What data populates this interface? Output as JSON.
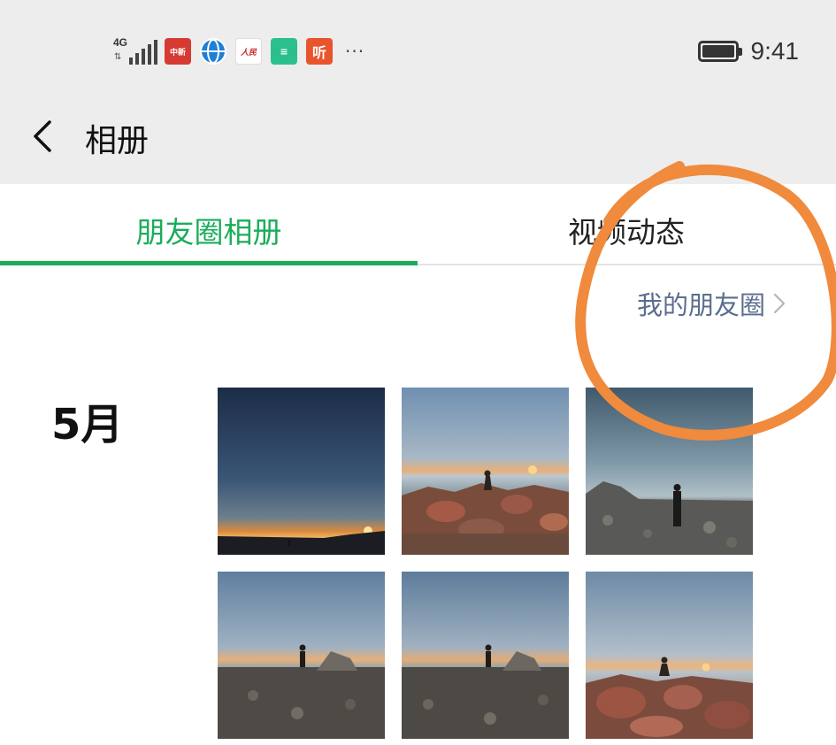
{
  "status_bar": {
    "network_type": "4G",
    "data_arrows": "⇅",
    "app_icons": [
      {
        "name": "news-app-icon",
        "glyph": "中新"
      },
      {
        "name": "globe-app-icon",
        "glyph": ""
      },
      {
        "name": "people-daily-app-icon",
        "glyph": "人民"
      },
      {
        "name": "notes-app-icon",
        "glyph": "≡"
      },
      {
        "name": "listen-app-icon",
        "glyph": "听"
      }
    ],
    "more_indicator": "···",
    "time": "9:41"
  },
  "nav": {
    "title": "相册"
  },
  "tabs": [
    {
      "label": "朋友圈相册",
      "active": true
    },
    {
      "label": "视频动态",
      "active": false
    }
  ],
  "my_moments_link": "我的朋友圈",
  "month_label": "5月",
  "photos": [
    {
      "scene": "sunset-beach-dusk"
    },
    {
      "scene": "sunset-rocks-person-seated"
    },
    {
      "scene": "person-standing-on-rocky-shore"
    },
    {
      "scene": "sunset-person-near-boulder"
    },
    {
      "scene": "sunset-person-near-boulder-2"
    },
    {
      "scene": "sunset-person-seated-on-rocks"
    }
  ],
  "colors": {
    "accent_green": "#1aad5a",
    "link_blue": "#5b6d8e",
    "nav_background": "#ededed",
    "annotation_orange": "#f08a3c"
  }
}
